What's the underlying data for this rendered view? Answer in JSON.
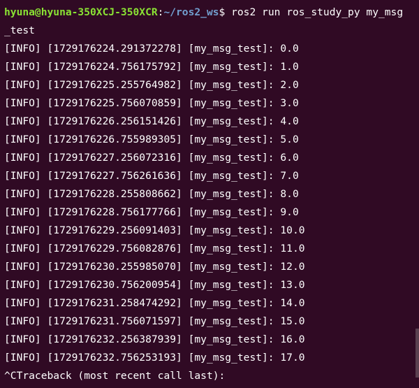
{
  "terminal": {
    "prompt": {
      "user_host": "hyuna@hyuna-350XCJ-350XCR",
      "separator": ":",
      "path": "~/ros2_ws",
      "symbol": "$",
      "command": " ros2 run ros_study_py my_msg",
      "command_wrap": "_test"
    },
    "log_lines": [
      "[INFO] [1729176224.291372278] [my_msg_test]: 0.0",
      "[INFO] [1729176224.756175792] [my_msg_test]: 1.0",
      "[INFO] [1729176225.255764982] [my_msg_test]: 2.0",
      "[INFO] [1729176225.756070859] [my_msg_test]: 3.0",
      "[INFO] [1729176226.256151426] [my_msg_test]: 4.0",
      "[INFO] [1729176226.755989305] [my_msg_test]: 5.0",
      "[INFO] [1729176227.256072316] [my_msg_test]: 6.0",
      "[INFO] [1729176227.756261636] [my_msg_test]: 7.0",
      "[INFO] [1729176228.255808662] [my_msg_test]: 8.0",
      "[INFO] [1729176228.756177766] [my_msg_test]: 9.0",
      "[INFO] [1729176229.256091403] [my_msg_test]: 10.0",
      "[INFO] [1729176229.756082876] [my_msg_test]: 11.0",
      "[INFO] [1729176230.255985070] [my_msg_test]: 12.0",
      "[INFO] [1729176230.756200954] [my_msg_test]: 13.0",
      "[INFO] [1729176231.258474292] [my_msg_test]: 14.0",
      "[INFO] [1729176231.756071597] [my_msg_test]: 15.0",
      "[INFO] [1729176232.256387939] [my_msg_test]: 16.0",
      "[INFO] [1729176232.756253193] [my_msg_test]: 17.0"
    ],
    "traceback_line": "^CTraceback (most recent call last):",
    "colors": {
      "background": "#300a24",
      "text": "#ffffff",
      "user_host": "#8ae234",
      "path": "#729fcf"
    }
  }
}
